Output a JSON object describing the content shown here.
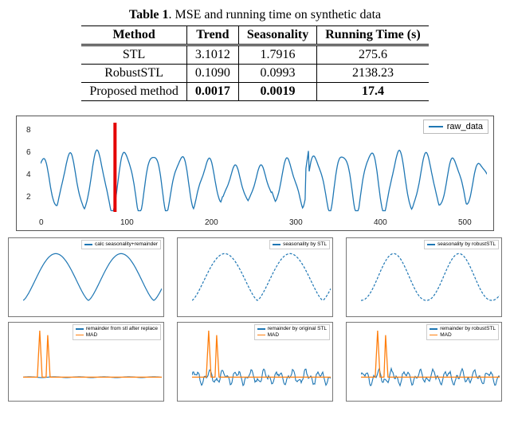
{
  "table": {
    "caption_bold": "Table 1",
    "caption_rest": ". MSE and running time on synthetic data",
    "headers": [
      "Method",
      "Trend",
      "Seasonality",
      "Running Time (s)"
    ],
    "rows": [
      {
        "method": "STL",
        "trend": "3.1012",
        "seasonality": "1.7916",
        "time": "275.6",
        "bold": false
      },
      {
        "method": "RobustSTL",
        "trend": "0.1090",
        "seasonality": "0.0993",
        "time": "2138.23",
        "bold": false
      },
      {
        "method": "Proposed method",
        "trend": "0.0017",
        "seasonality": "0.0019",
        "time": "17.4",
        "bold": true
      }
    ]
  },
  "main_chart": {
    "legend": "raw_data",
    "y_ticks": [
      2,
      4,
      6,
      8
    ],
    "x_ticks": [
      0,
      100,
      200,
      300,
      400,
      500
    ],
    "marker_x": 70
  },
  "small_charts": {
    "row1": [
      {
        "legend1": "calc seasonality+remainder"
      },
      {
        "legend1": "seasonality by STL",
        "legend2": ""
      },
      {
        "legend1": "seasonality by robustSTL",
        "legend2": ""
      }
    ],
    "row2": [
      {
        "legend1": "remainder from stl after replace",
        "legend2": "MAD"
      },
      {
        "legend1": "remainder by original STL",
        "legend2": "MAD"
      },
      {
        "legend1": "remainder by robustSTL",
        "legend2": "MAD"
      }
    ]
  },
  "chart_data": [
    {
      "type": "line",
      "title": "",
      "series": [
        {
          "name": "raw_data",
          "note": "oscillating time series ~1–8 with peaks every ~30 units, vertical red marker at x≈70"
        }
      ],
      "xlim": [
        0,
        520
      ],
      "ylim": [
        1,
        8.5
      ],
      "x_ticks": [
        0,
        100,
        200,
        300,
        400,
        500
      ],
      "y_ticks": [
        2,
        4,
        6,
        8
      ]
    },
    {
      "type": "line",
      "title": "calc seasonality+remainder",
      "series": [
        {
          "name": "calc seasonality+remainder",
          "note": "smooth seasonal waveform over ~70 samples"
        }
      ],
      "xlim": [
        0,
        70
      ],
      "ylim": [
        0,
        6
      ]
    },
    {
      "type": "line",
      "title": "seasonality by STL",
      "series": [
        {
          "name": "seasonality by STL",
          "note": "dashed seasonal waveform"
        }
      ],
      "xlim": [
        0,
        70
      ],
      "ylim": [
        0,
        6
      ]
    },
    {
      "type": "line",
      "title": "seasonality by robustSTL",
      "series": [
        {
          "name": "seasonality by robustSTL",
          "note": "dashed seasonal waveform, sharper"
        }
      ],
      "xlim": [
        0,
        70
      ],
      "ylim": [
        0,
        6
      ]
    },
    {
      "type": "line",
      "title": "remainder from stl after replace + MAD",
      "series": [
        {
          "name": "remainder from stl after replace",
          "note": "near-zero residual (blue)"
        },
        {
          "name": "MAD",
          "note": "spike near x≈8 then flat (orange)"
        }
      ],
      "xlim": [
        0,
        70
      ],
      "ylim": [
        -1,
        6
      ]
    },
    {
      "type": "line",
      "title": "remainder by original STL + MAD",
      "series": [
        {
          "name": "remainder by original STL",
          "note": "noisy residual around 0 (blue)"
        },
        {
          "name": "MAD",
          "note": "spike near x≈8 (orange)"
        }
      ],
      "xlim": [
        0,
        70
      ],
      "ylim": [
        -2,
        6
      ]
    },
    {
      "type": "line",
      "title": "remainder by robustSTL + MAD",
      "series": [
        {
          "name": "remainder by robustSTL",
          "note": "noisy residual (blue)"
        },
        {
          "name": "MAD",
          "note": "spike near x≈8 (orange)"
        }
      ],
      "xlim": [
        0,
        70
      ],
      "ylim": [
        -2,
        6
      ]
    }
  ]
}
